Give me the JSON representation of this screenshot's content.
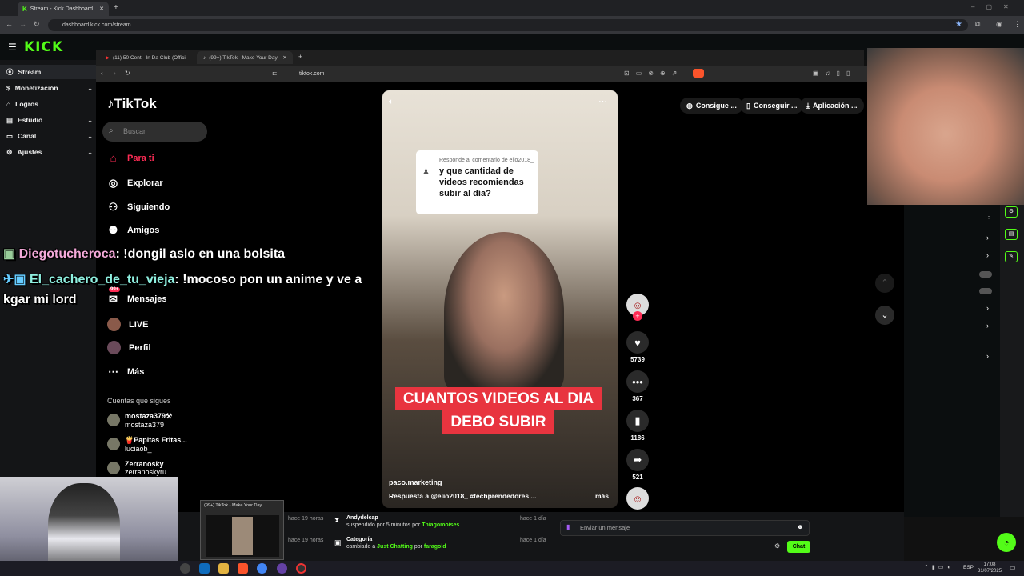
{
  "outer_browser": {
    "tab_title": "Stream - Kick Dashboard",
    "url": "dashboard.kick.com/stream"
  },
  "kick": {
    "logo": "KICK",
    "nav": [
      {
        "label": "Stream",
        "icon": "stream-icon"
      },
      {
        "label": "Monetización",
        "icon": "money-icon"
      },
      {
        "label": "Logros",
        "icon": "trophy-icon"
      },
      {
        "label": "Estudio",
        "icon": "studio-icon"
      },
      {
        "label": "Canal",
        "icon": "channel-icon"
      },
      {
        "label": "Ajustes",
        "icon": "gear-icon"
      }
    ],
    "activity": [
      {
        "user": "Andydelcap",
        "text": "suspendido por 5 minutos por",
        "by": "Thiagomoises",
        "time": "hace 1 día"
      },
      {
        "user": "Categoría",
        "text": "cambiado a",
        "value": "Just Chatting",
        "by_prefix": "por",
        "by": "faragold",
        "time": "hace 1 día"
      }
    ],
    "left_times": [
      "hace 19 horas",
      "hace 19 horas"
    ],
    "message_placeholder": "Enviar un mensaje",
    "chat_button": "Chat"
  },
  "inner_browser": {
    "tabs": [
      {
        "label": "(11) 50 Cent - In Da Club (Officia"
      },
      {
        "label": "(99+) TikTok - Make Your Day"
      }
    ],
    "url": "tiktok.com"
  },
  "tiktok": {
    "logo": "TikTok",
    "search_placeholder": "Buscar",
    "nav": [
      {
        "label": "Para ti",
        "icon": "home-icon"
      },
      {
        "label": "Explorar",
        "icon": "compass-icon"
      },
      {
        "label": "Siguiendo",
        "icon": "following-icon"
      },
      {
        "label": "Amigos",
        "icon": "friends-icon"
      },
      {
        "label": "Mensajes",
        "icon": "inbox-icon",
        "badge": "99+"
      },
      {
        "label": "LIVE",
        "icon": "live-icon"
      },
      {
        "label": "Perfil",
        "icon": "profile-icon"
      },
      {
        "label": "Más",
        "icon": "more-icon"
      }
    ],
    "following_heading": "Cuentas que sigues",
    "following": [
      {
        "name": "mostaza379⚒",
        "handle": "mostaza379"
      },
      {
        "name": "🍟Papitas Fritas...",
        "handle": "luciaob_"
      },
      {
        "name": "Zerranosky",
        "handle": "zerranoskyru"
      }
    ],
    "top_pills": [
      "Consigue ...",
      "Conseguir ...",
      "Aplicación ..."
    ],
    "video": {
      "reply_sub": "Responde al comentario de elio2018_",
      "reply_question": "y que cantidad de videos recomiendas subir al día?",
      "caption_line1": "CUANTOS VIDEOS AL DIA",
      "caption_line2": "DEBO SUBIR",
      "author": "paco.marketing",
      "description": "Respuesta a @elio2018_ #techprendedores ...",
      "more": "más"
    },
    "actions": {
      "likes": "5739",
      "comments": "367",
      "saves": "1186",
      "shares": "521"
    }
  },
  "chat_overlay": [
    {
      "user": "Diegotucheroca",
      "message": "!dongil aslo en una bolsita",
      "user_color": "#f3a8d8"
    },
    {
      "user": "El_cachero_de_tu_vieja",
      "message": "!mocoso pon un anime y ve a",
      "cont": "kgar mi lord",
      "user_color": "#8ff0e0"
    }
  ],
  "taskbar": {
    "preview_title": "(99+) TikTok - Make Your Day ...",
    "lang": "ESP",
    "time": "17:08",
    "date": "31/07/2025"
  }
}
